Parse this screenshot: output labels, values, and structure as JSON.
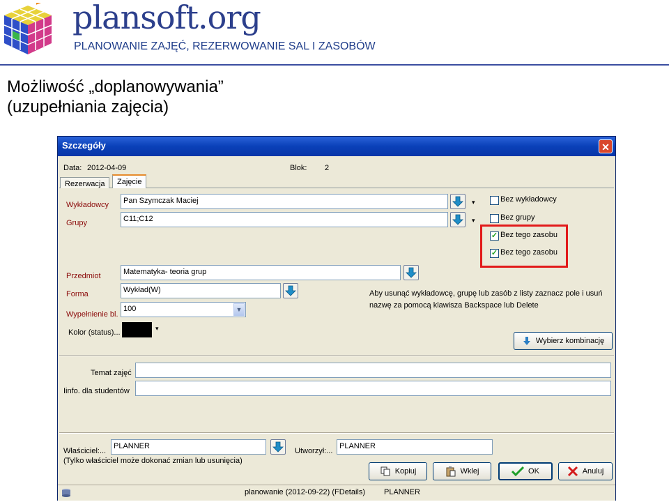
{
  "slide": {
    "brand": "plansoft.org",
    "tagline": "PLANOWANIE ZAJĘĆ, REZERWOWANIE SAL I ZASOBÓW",
    "heading_line1": "Możliwość „doplanowywania”",
    "heading_line2": "(uzupełniania zajęcia)"
  },
  "dialog": {
    "title": "Szczegóły",
    "close_glyph": "✕",
    "date_label": "Data:",
    "date_value": "2012-04-09",
    "block_label": "Blok:",
    "block_value": "2",
    "tabs": [
      {
        "label": "Rezerwacja"
      },
      {
        "label": "Zajęcie"
      }
    ],
    "lecturers_label": "Wykładowcy",
    "lecturers_value": "Pan Szymczak Maciej",
    "groups_label": "Grupy",
    "groups_value": "C11;C12",
    "checkboxes": [
      {
        "label": "Bez wykładowcy",
        "checked": false
      },
      {
        "label": "Bez grupy",
        "checked": false
      },
      {
        "label": "Bez tego zasobu",
        "checked": true
      },
      {
        "label": "Bez tego zasobu",
        "checked": true
      }
    ],
    "subject_label": "Przedmiot",
    "subject_value": "Matematyka- teoria grup",
    "form_label": "Forma",
    "form_value": "Wykład(W)",
    "fill_label": "Wypełnienie bl.",
    "fill_value": "100",
    "color_label": "Kolor (status)...",
    "color_swatch": "#000000",
    "hint": "Aby usunąć wykładowcę, grupę lub zasób z listy zaznacz pole i usuń nazwę za pomocą klawisza Backspace lub Delete",
    "choose_combination": "Wybierz kombinację",
    "topic_label": "Temat zajęć",
    "topic_value": "",
    "info_label": "Iinfo. dla studentów",
    "info_value": "",
    "owner_label": "Właściciel:...",
    "owner_value": "PLANNER",
    "created_label": "Utworzył:...",
    "created_value": "PLANNER",
    "owner_note": "(Tylko właściciel może dokonać zmian lub usunięcia)",
    "copy_button": "Kopiuj",
    "paste_button": "Wklej",
    "ok_button": "OK",
    "cancel_button": "Anuluj",
    "status_text": "planowanie (2012-09-22) (FDetails)",
    "status_user": "PLANNER"
  },
  "colors": {
    "accent_red": "#e21a1a",
    "titlebar_blue": "#0a40b8",
    "brand_blue": "#2c3f8c"
  }
}
